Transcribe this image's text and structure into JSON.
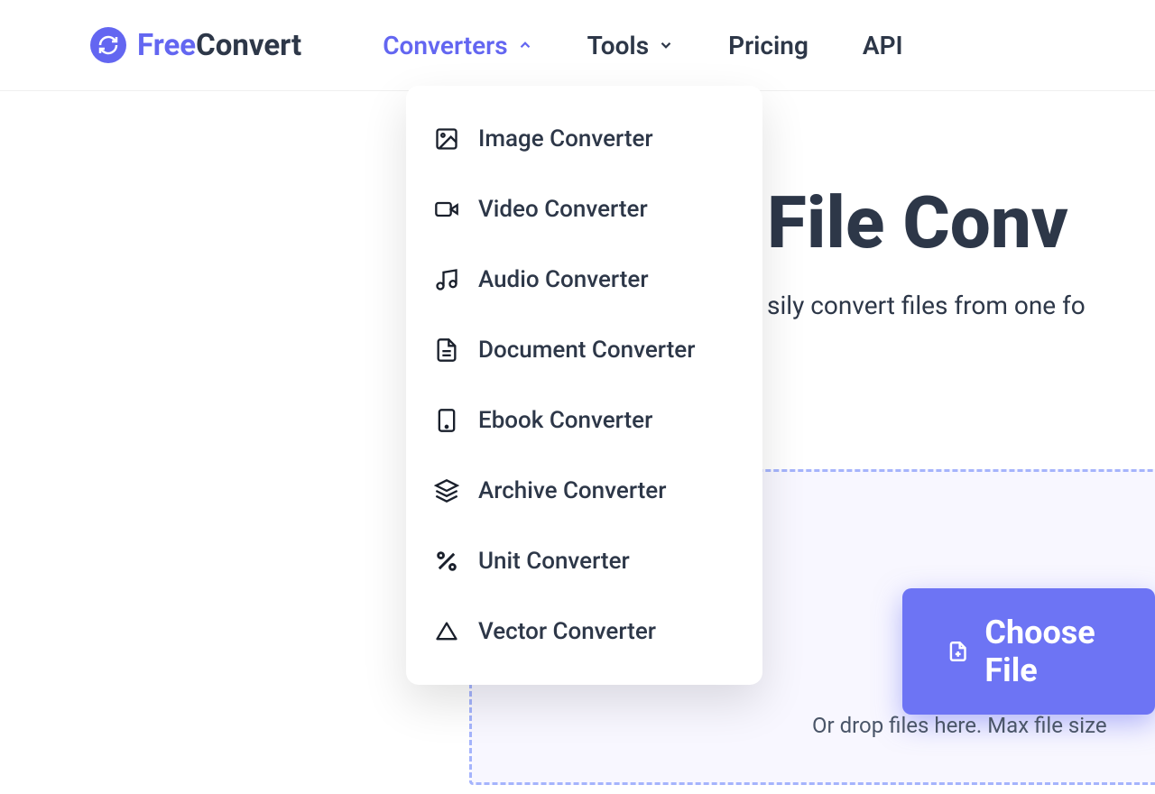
{
  "brand": {
    "free": "Free",
    "convert": "Convert"
  },
  "nav": {
    "converters": "Converters",
    "tools": "Tools",
    "pricing": "Pricing",
    "api": "API"
  },
  "dropdown": {
    "items": [
      {
        "label": "Image Converter",
        "icon": "image"
      },
      {
        "label": "Video Converter",
        "icon": "video"
      },
      {
        "label": "Audio Converter",
        "icon": "audio"
      },
      {
        "label": "Document Converter",
        "icon": "document"
      },
      {
        "label": "Ebook Converter",
        "icon": "ebook"
      },
      {
        "label": "Archive Converter",
        "icon": "archive"
      },
      {
        "label": "Unit Converter",
        "icon": "unit"
      },
      {
        "label": "Vector Converter",
        "icon": "vector"
      }
    ]
  },
  "hero": {
    "title": "File Conv",
    "subtitle": "sily convert files from one fo"
  },
  "upload": {
    "button": "Choose File",
    "hint": "Or drop files here. Max file size"
  }
}
